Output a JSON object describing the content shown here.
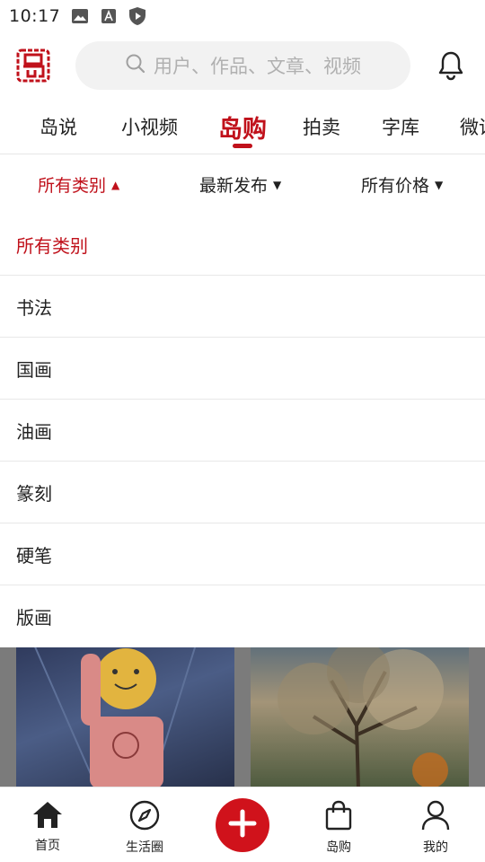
{
  "status_bar": {
    "time": "10:17",
    "icons": [
      "image-icon",
      "font-a-icon",
      "shield-play-icon"
    ]
  },
  "header": {
    "logo_icon": "dao-seal-logo",
    "search": {
      "placeholder": "用户、作品、文章、视频",
      "icon": "search-icon"
    },
    "bell_icon": "bell-icon"
  },
  "tabs": [
    {
      "label": "岛说"
    },
    {
      "label": "小视频"
    },
    {
      "label": "岛购",
      "active": true
    },
    {
      "label": "拍卖"
    },
    {
      "label": "字库"
    },
    {
      "label": "微读"
    }
  ],
  "filters": [
    {
      "label": "所有类别",
      "active": true,
      "caret": "▲"
    },
    {
      "label": "最新发布",
      "caret": "▼"
    },
    {
      "label": "所有价格",
      "caret": "▼"
    }
  ],
  "dropdown": {
    "items": [
      "所有类别",
      "书法",
      "国画",
      "油画",
      "篆刻",
      "硬笔",
      "版画"
    ],
    "selected": "所有类别"
  },
  "bottom_nav": {
    "items": [
      {
        "label": "首页",
        "icon": "home-icon"
      },
      {
        "label": "生活圈",
        "icon": "compass-icon"
      },
      {
        "label": "",
        "icon": "plus-icon"
      },
      {
        "label": "岛购",
        "icon": "shopping-bag-icon"
      },
      {
        "label": "我的",
        "icon": "user-icon"
      }
    ]
  },
  "colors": {
    "accent": "#c0111b",
    "plus_button": "#d0121b",
    "search_bg": "#f2f2f2"
  }
}
